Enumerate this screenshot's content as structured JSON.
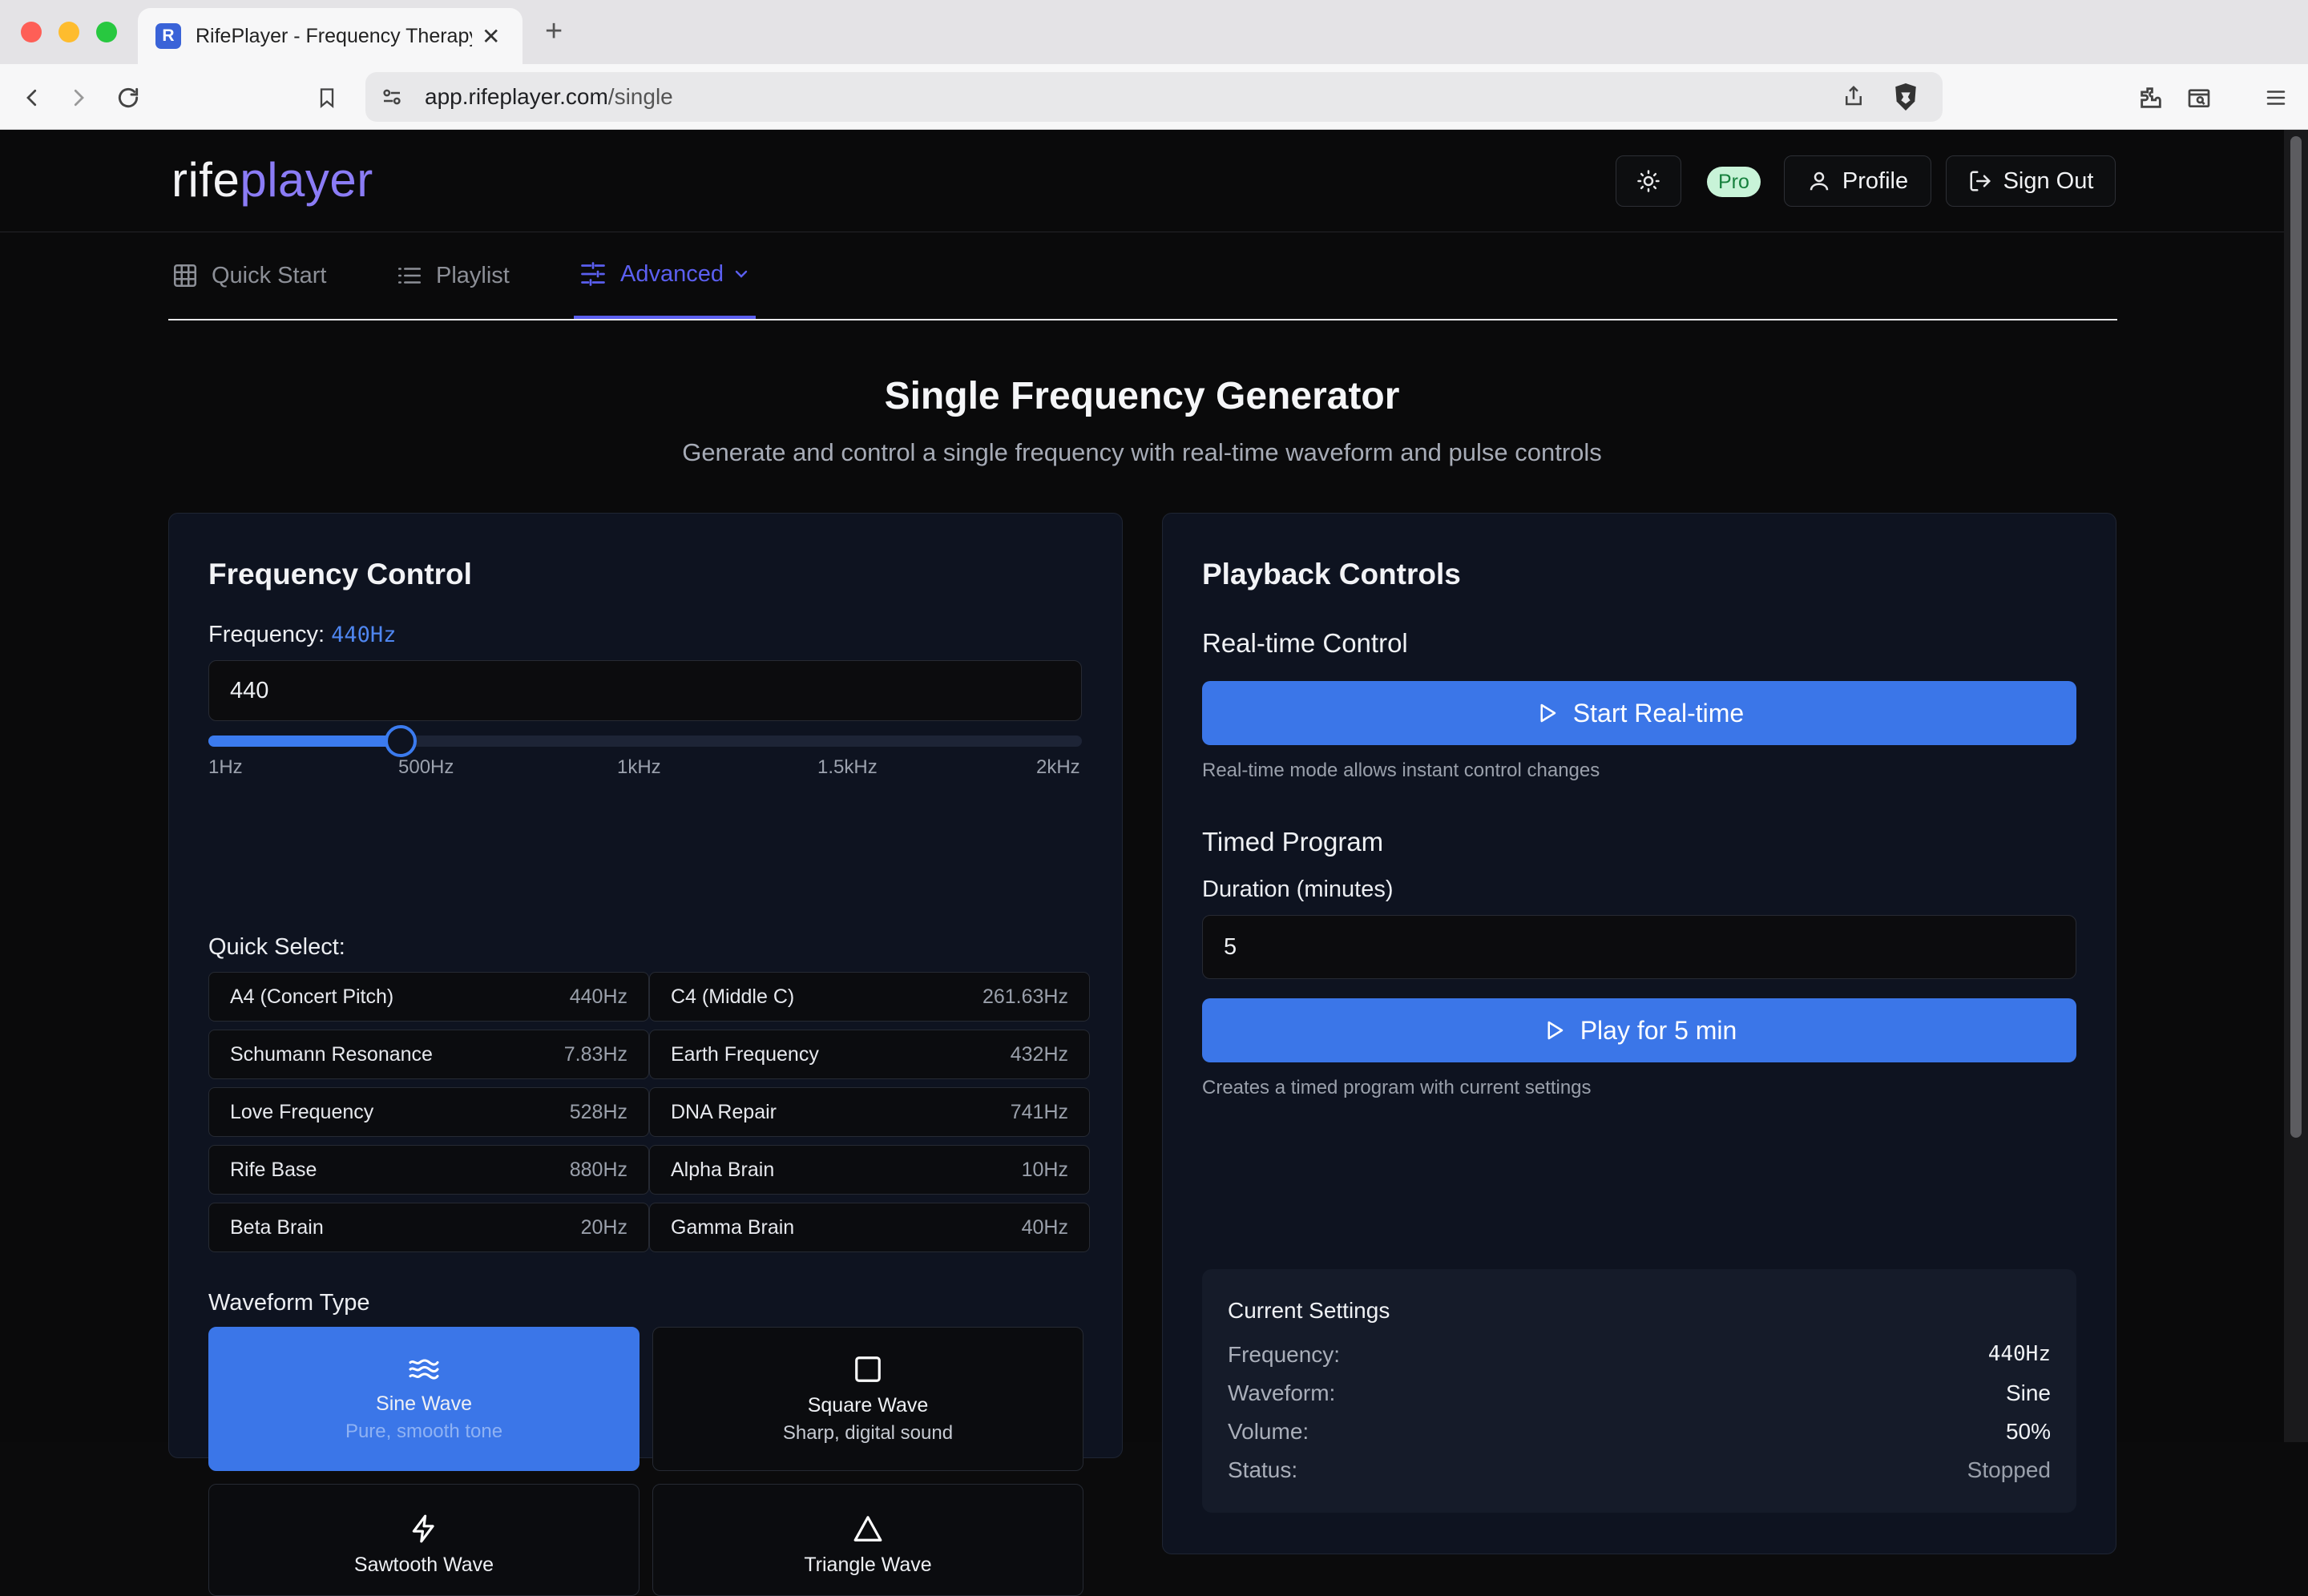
{
  "browser": {
    "tab_title": "RifePlayer - Frequency Therapy",
    "url_host": "app.rifeplayer.com",
    "url_path": "/single",
    "favicon_letter": "R"
  },
  "header": {
    "logo_part1": "rife",
    "logo_part2": "player",
    "badge": "Pro",
    "profile_label": "Profile",
    "signout_label": "Sign Out"
  },
  "nav": {
    "quick_start": "Quick Start",
    "playlist": "Playlist",
    "advanced": "Advanced"
  },
  "page": {
    "title": "Single Frequency Generator",
    "subtitle": "Generate and control a single frequency with real-time waveform and pulse controls"
  },
  "frequency_control": {
    "title": "Frequency Control",
    "freq_label": "Frequency:",
    "freq_value": "440Hz",
    "input_value": "440",
    "slider_fraction": 0.22,
    "ticks": [
      "1Hz",
      "500Hz",
      "1kHz",
      "1.5kHz",
      "2kHz"
    ],
    "quick_select_label": "Quick Select:",
    "quick_select": [
      {
        "name": "A4 (Concert Pitch)",
        "value": "440Hz"
      },
      {
        "name": "C4 (Middle C)",
        "value": "261.63Hz"
      },
      {
        "name": "Schumann Resonance",
        "value": "7.83Hz"
      },
      {
        "name": "Earth Frequency",
        "value": "432Hz"
      },
      {
        "name": "Love Frequency",
        "value": "528Hz"
      },
      {
        "name": "DNA Repair",
        "value": "741Hz"
      },
      {
        "name": "Rife Base",
        "value": "880Hz"
      },
      {
        "name": "Alpha Brain",
        "value": "10Hz"
      },
      {
        "name": "Beta Brain",
        "value": "20Hz"
      },
      {
        "name": "Gamma Brain",
        "value": "40Hz"
      }
    ],
    "waveform_label": "Waveform Type",
    "waveforms": [
      {
        "name": "Sine Wave",
        "desc": "Pure, smooth tone",
        "icon": "waves-icon"
      },
      {
        "name": "Square Wave",
        "desc": "Sharp, digital sound",
        "icon": "square-icon"
      },
      {
        "name": "Sawtooth Wave",
        "desc": "",
        "icon": "zap-icon"
      },
      {
        "name": "Triangle Wave",
        "desc": "",
        "icon": "triangle-icon"
      }
    ]
  },
  "playback": {
    "title": "Playback Controls",
    "realtime_heading": "Real-time Control",
    "start_label": "Start Real-time",
    "realtime_hint": "Real-time mode allows instant control changes",
    "timed_heading": "Timed Program",
    "duration_label": "Duration (minutes)",
    "duration_value": "5",
    "play_label": "Play for 5 min",
    "timed_hint": "Creates a timed program with current settings",
    "settings_title": "Current Settings",
    "settings": [
      {
        "key": "Frequency:",
        "value": "440Hz"
      },
      {
        "key": "Waveform:",
        "value": "Sine"
      },
      {
        "key": "Volume:",
        "value": "50%"
      },
      {
        "key": "Status:",
        "value": "Stopped"
      }
    ]
  },
  "colors": {
    "accent": "#3b76e8",
    "nav_active": "#5b5ff0",
    "pro_badge_bg": "#c8f3d8",
    "pro_badge_text": "#16803d"
  }
}
